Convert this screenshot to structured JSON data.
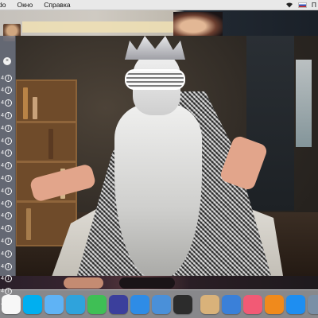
{
  "menubar": {
    "items": [
      "do",
      "Окно",
      "Справка"
    ],
    "status_icons": [
      "wifi-icon",
      "russian-flag-icon"
    ],
    "clock": "П"
  },
  "sidebar": {
    "head_icon": "close-icon",
    "rows": [
      {
        "label": "4",
        "icon": "info-icon"
      },
      {
        "label": "4",
        "icon": "info-icon"
      },
      {
        "label": "4",
        "icon": "info-icon"
      },
      {
        "label": "4",
        "icon": "info-icon"
      },
      {
        "label": "4",
        "icon": "info-icon"
      },
      {
        "label": "4",
        "icon": "info-icon"
      },
      {
        "label": "4",
        "icon": "info-icon"
      },
      {
        "label": "4",
        "icon": "info-icon"
      },
      {
        "label": "4",
        "icon": "info-icon"
      },
      {
        "label": "4",
        "icon": "info-icon"
      },
      {
        "label": "4",
        "icon": "info-icon"
      },
      {
        "label": "4",
        "icon": "info-icon"
      },
      {
        "label": "4",
        "icon": "info-icon"
      },
      {
        "label": "4",
        "icon": "info-icon"
      },
      {
        "label": "4",
        "icon": "info-icon"
      },
      {
        "label": "4",
        "icon": "info-icon"
      },
      {
        "label": "4",
        "icon": "info-icon"
      },
      {
        "label": "4",
        "icon": "info-icon"
      },
      {
        "label": "4",
        "icon": "info-icon"
      }
    ]
  },
  "dock": {
    "apps": [
      {
        "name": "photos-app-icon",
        "color": "#f7f7f7"
      },
      {
        "name": "skype-app-icon",
        "color": "#00aff0"
      },
      {
        "name": "messages-app-icon",
        "color": "#5fb3f5"
      },
      {
        "name": "telegram-app-icon",
        "color": "#2fa3dc"
      },
      {
        "name": "facetime-app-icon",
        "color": "#3fbf55"
      },
      {
        "name": "siri-app-icon",
        "color": "#3b3f9c"
      },
      {
        "name": "safari-app-icon",
        "color": "#2e8ce6"
      },
      {
        "name": "network-app-icon",
        "color": "#4a90d9"
      },
      {
        "name": "media-app-icon",
        "color": "#2c2c2c"
      },
      {
        "name": "preview-app-icon",
        "color": "#d9b27a"
      },
      {
        "name": "keynote-app-icon",
        "color": "#3a80d9"
      },
      {
        "name": "music-app-icon",
        "color": "#f25a75"
      },
      {
        "name": "books-app-icon",
        "color": "#f08a1c"
      },
      {
        "name": "app-store-icon",
        "color": "#1e8ef1"
      },
      {
        "name": "system-app-icon",
        "color": "#7a8fa6"
      }
    ]
  }
}
